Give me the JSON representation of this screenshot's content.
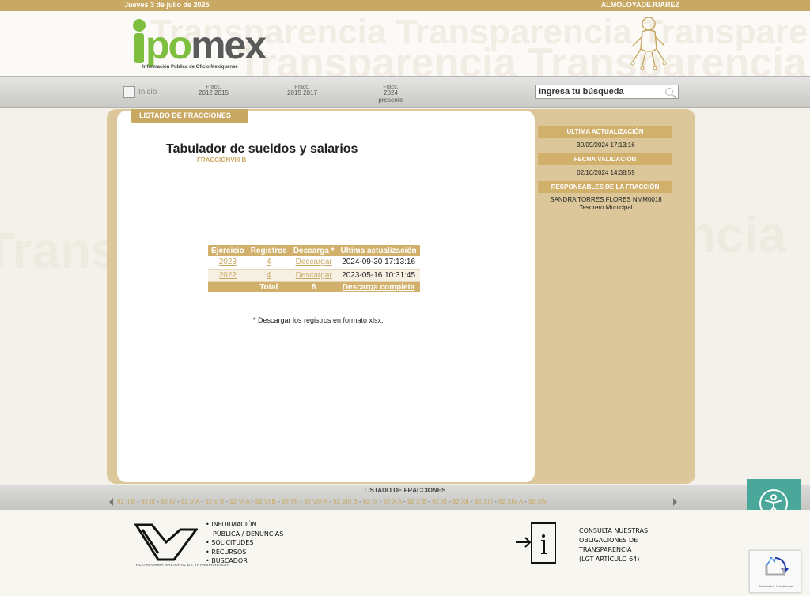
{
  "topbar": {
    "date": "Jueves 3 de julio de 2025",
    "municipality": "ALMOLOYADEJUAREZ"
  },
  "logo": {
    "word": "pomex",
    "tagline": "Información Pública de Oficio Mexiquense"
  },
  "nav": {
    "home_label": "Inicio",
    "fracc_items": [
      {
        "label": "Fracc.",
        "years": "2012 2015"
      },
      {
        "label": "Fracc.",
        "years": "2015 2017"
      },
      {
        "label": "Fracc.",
        "years": "2024 presente"
      }
    ],
    "search_placeholder": "Ingresa tu búsqueda"
  },
  "main": {
    "tab_label": "LISTADO DE FRACCIONES",
    "title": "Tabulador de sueldos y salarios",
    "subtitle": "FRACCIÓNVIII B",
    "table": {
      "headers": [
        "Ejercicio",
        "Registros",
        "Descarga *",
        "Ultima actualización"
      ],
      "rows": [
        {
          "ejercicio": "2023",
          "registros": "4",
          "descarga": "Descargar",
          "actualizacion": "2024-09-30 17:13:16"
        },
        {
          "ejercicio": "2022",
          "registros": "4",
          "descarga": "Descargar",
          "actualizacion": "2023-05-16 10:31:45"
        }
      ],
      "total_label": "Total",
      "total_value": "8",
      "download_all": "Descarga completa"
    },
    "note": "* Descargar los registros en formato xlsx."
  },
  "side": {
    "last_update_title": "ULTIMA ACTUALIZACIÓN",
    "last_update_value": "30/09/2024 17:13:16",
    "validation_title": "FECHA VALIDACIÓN",
    "validation_value": "02/10/2024 14:38:59",
    "responsables_title": "RESPONSABLES DE LA FRACCIÓN",
    "responsable_name": "SANDRA TORRES FLORES NMM0018",
    "responsable_role": "Tesorero Municipal"
  },
  "bottom": {
    "title": "LISTADO DE FRACCIONES",
    "links": [
      "92 II B",
      "92 III",
      "92 IV",
      "92 V A",
      "92 V B",
      "92 VI A",
      "92 VI B",
      "92 VII",
      "92 VIII A",
      "92 VIII B",
      "92 IX",
      "92 X A",
      "92 X B",
      "92 XI",
      "92 XII",
      "92 XIII",
      "92 XIV A",
      "92 XIV"
    ]
  },
  "footer": {
    "pnt_label": "PLATAFORMA NACIONAL DE TRANSPARENCIA",
    "list": [
      "INFORMACIÓN",
      "PÚBLICA / DENUNCIAS",
      "SOLICITUDES",
      "RECURSOS",
      "BUSCADOR"
    ],
    "consulta": [
      "CONSULTA NUESTRAS",
      "OBLIGACIONES DE",
      "TRANSPARENCIA",
      "(LGT ARTÍCULO 64)"
    ]
  },
  "recaptcha": {
    "text": "Privacidad - Condiciones"
  },
  "colors": {
    "gold": "#c9a863",
    "green": "#7fbf3f",
    "teal": "#4aa89a"
  }
}
